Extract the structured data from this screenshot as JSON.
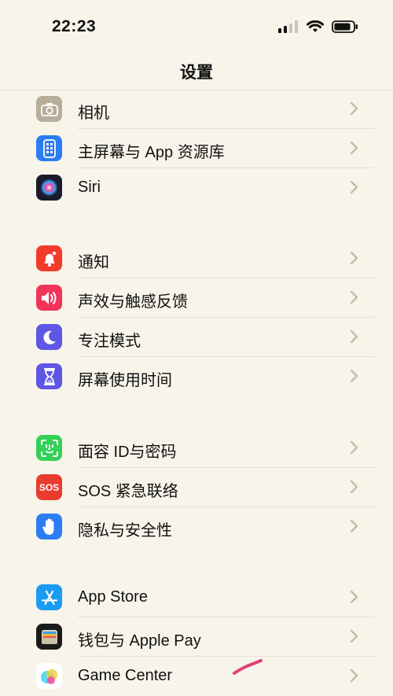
{
  "status_bar": {
    "time": "22:23"
  },
  "nav": {
    "title": "设置"
  },
  "groups": [
    {
      "items": [
        {
          "label": "相机",
          "icon": "camera-icon",
          "color": "#b7ad9a"
        },
        {
          "label": "主屏幕与 App 资源库",
          "icon": "home-screen-icon",
          "color": "#2b7df5"
        },
        {
          "label": "Siri",
          "icon": "siri-icon",
          "color": "#1b1b2e"
        }
      ]
    },
    {
      "items": [
        {
          "label": "通知",
          "icon": "notifications-icon",
          "color": "#f23b2b"
        },
        {
          "label": "声效与触感反馈",
          "icon": "sounds-icon",
          "color": "#f2335a"
        },
        {
          "label": "专注模式",
          "icon": "focus-moon-icon",
          "color": "#5f56e6"
        },
        {
          "label": "屏幕使用时间",
          "icon": "hourglass-icon",
          "color": "#5f56e6"
        }
      ]
    },
    {
      "items": [
        {
          "label": "面容 ID与密码",
          "icon": "face-id-icon",
          "color": "#34d058"
        },
        {
          "label": "SOS 紧急联络",
          "icon": "sos-icon",
          "color": "#ea3b2e",
          "icon_text": "SOS"
        },
        {
          "label": "隐私与安全性",
          "icon": "privacy-hand-icon",
          "color": "#2b7df5"
        }
      ]
    },
    {
      "items": [
        {
          "label": "App Store",
          "icon": "app-store-icon",
          "color": "#1a9cf2"
        },
        {
          "label": "钱包与 Apple Pay",
          "icon": "wallet-icon",
          "color": "#1a1a1a"
        },
        {
          "label": "Game Center",
          "icon": "game-center-icon",
          "color": "#ffffff"
        }
      ]
    }
  ]
}
